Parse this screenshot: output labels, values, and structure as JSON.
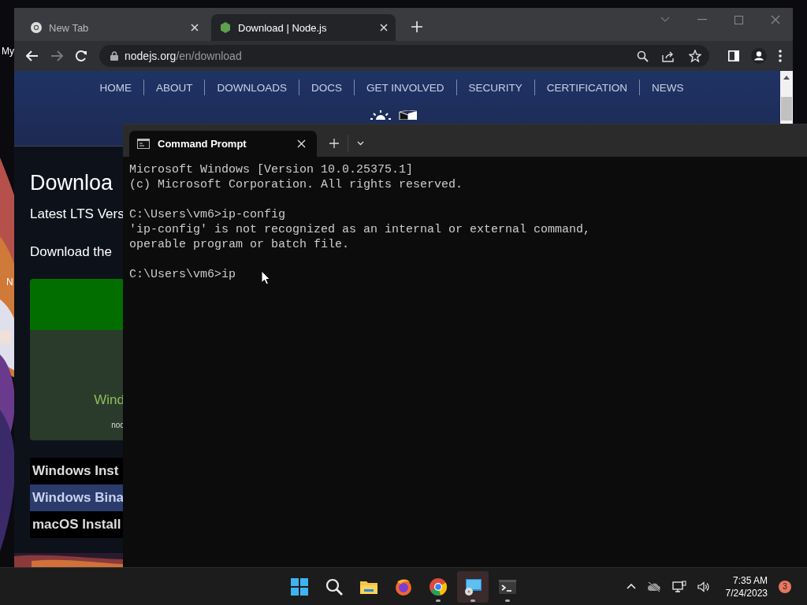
{
  "desktop": {
    "icons": [
      {
        "label": "My"
      },
      {
        "label": "N"
      }
    ]
  },
  "browser": {
    "tabs": [
      {
        "title": "New Tab",
        "kind": "chrome",
        "selected": false
      },
      {
        "title": "Download | Node.js",
        "kind": "node",
        "selected": true
      }
    ],
    "address": {
      "host": "nodejs.org",
      "path": "/en/download"
    },
    "nav": [
      "HOME",
      "ABOUT",
      "DOWNLOADS",
      "DOCS",
      "GET INVOLVED",
      "SECURITY",
      "CERTIFICATION",
      "NEWS"
    ],
    "page": {
      "heading": "Downloa",
      "subheading": "Latest LTS Vers",
      "intro": "Download the",
      "card": {
        "label": "Wind",
        "caption": "nod"
      },
      "list": [
        {
          "label": "Windows Inst",
          "selected": false
        },
        {
          "label": "Windows Bina",
          "selected": true
        },
        {
          "label": "macOS Install",
          "selected": false
        }
      ]
    }
  },
  "terminal": {
    "tabs": [
      {
        "title": "Command Prompt",
        "selected": true
      }
    ],
    "blocks": [
      [
        "Microsoft Windows [Version 10.0.25375.1]",
        "(c) Microsoft Corporation. All rights reserved."
      ],
      [
        "C:\\Users\\vm6>ip-config",
        "'ip-config' is not recognized as an internal or external command,",
        "operable program or batch file."
      ],
      [
        "C:\\Users\\vm6>ip"
      ]
    ]
  },
  "taskbar": {
    "apps": [
      {
        "kind": "start",
        "running": false,
        "selected": false
      },
      {
        "kind": "search",
        "running": false,
        "selected": false
      },
      {
        "kind": "files",
        "running": false,
        "selected": false
      },
      {
        "kind": "firefox",
        "running": false,
        "selected": false
      },
      {
        "kind": "chrome",
        "running": true,
        "selected": false
      },
      {
        "kind": "remote",
        "running": true,
        "selected": true
      },
      {
        "kind": "terminal",
        "running": true,
        "selected": false
      }
    ],
    "time": "7:35 AM",
    "date": "7/24/2023",
    "badge": "3"
  }
}
